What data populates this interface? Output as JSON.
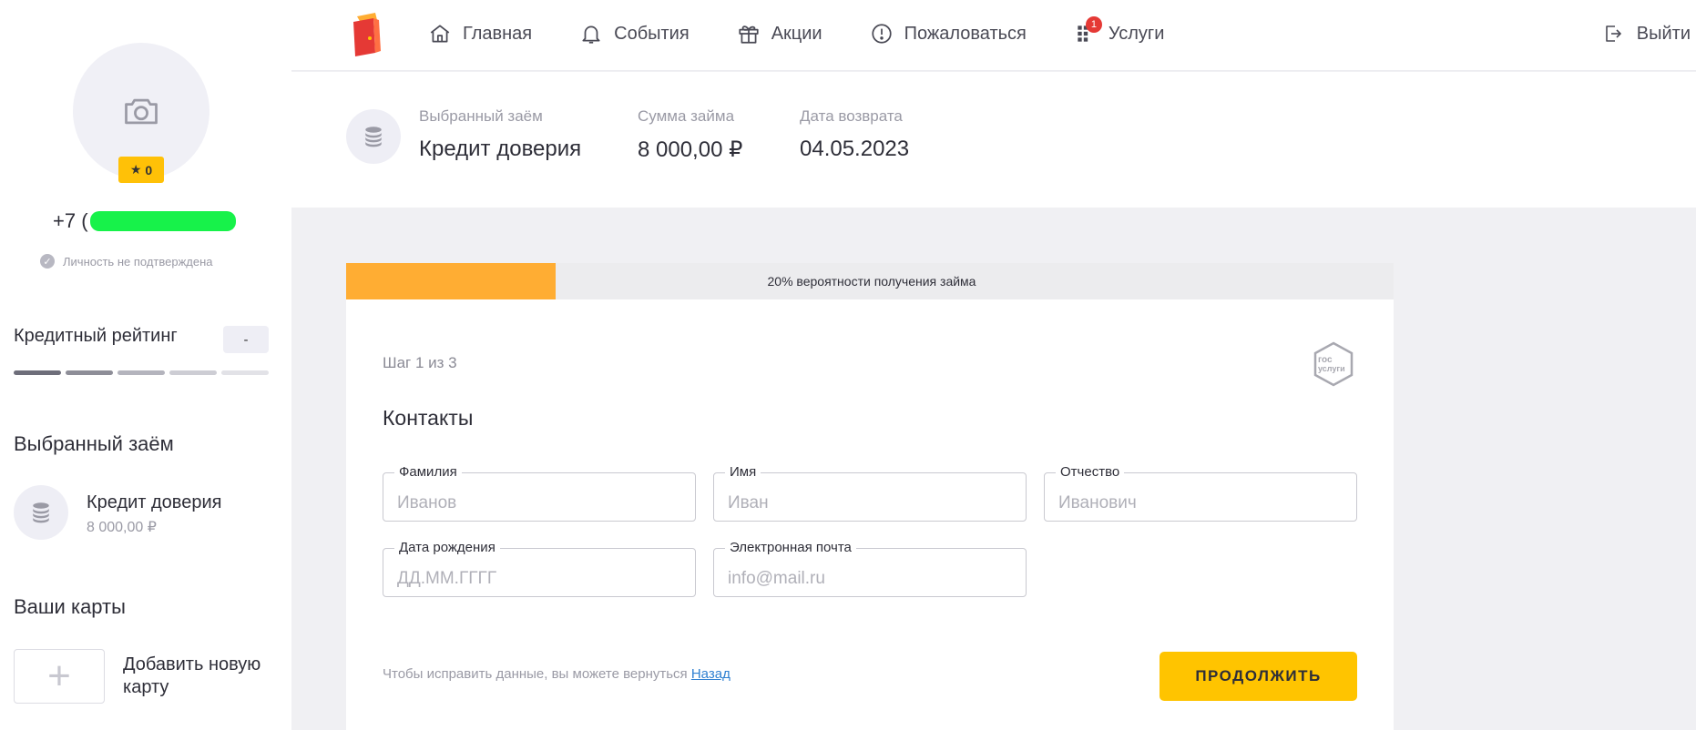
{
  "app": {
    "accent": "#ffc400",
    "progress_color": "#ffad33",
    "link_color": "#2f80d1"
  },
  "sidebar": {
    "avatar_icon": "camera-icon",
    "rating_badge": "0",
    "phone_prefix": "+7 (",
    "identity_status": "Личность не подтверждена",
    "credit_rating_label": "Кредитный рейтинг",
    "credit_rating_value": "-",
    "rating_bars": [
      "#6e6e7a",
      "#8e8e98",
      "#b4b4bd",
      "#cdcdd4",
      "#e2e2e7"
    ],
    "selected_loan_title": "Выбранный заём",
    "loan_name": "Кредит доверия",
    "loan_sum": "8 000,00 ₽",
    "cards_title": "Ваши карты",
    "add_card_label": "Добавить новую карту"
  },
  "header": {
    "nav": [
      {
        "label": "Главная",
        "icon": "home-icon"
      },
      {
        "label": "События",
        "icon": "bell-icon"
      },
      {
        "label": "Акции",
        "icon": "gift-icon"
      },
      {
        "label": "Пожаловаться",
        "icon": "exclamation-icon"
      },
      {
        "label": "Услуги",
        "icon": "grid-icon",
        "badge": "1"
      }
    ],
    "logout_label": "Выйти"
  },
  "loan_band": {
    "selected_label": "Выбранный заём",
    "selected_value": "Кредит доверия",
    "sum_label": "Сумма займа",
    "sum_value": "8 000,00 ₽",
    "date_label": "Дата возврата",
    "date_value": "04.05.2023"
  },
  "form": {
    "progress_percent": 20,
    "progress_label": "20% вероятности получения займа",
    "step": "Шаг 1 из 3",
    "gos_logo_line1": "гос",
    "gos_logo_line2": "услуги",
    "section_title": "Контакты",
    "fields": {
      "last_name": {
        "label": "Фамилия",
        "placeholder": "Иванов"
      },
      "first_name": {
        "label": "Имя",
        "placeholder": "Иван"
      },
      "patronymic": {
        "label": "Отчество",
        "placeholder": "Иванович"
      },
      "birth_date": {
        "label": "Дата рождения",
        "placeholder": "ДД.ММ.ГГГГ"
      },
      "email": {
        "label": "Электронная почта",
        "placeholder": "info@mail.ru"
      }
    },
    "back_text": "Чтобы исправить данные, вы можете вернуться",
    "back_link": "Назад",
    "continue_label": "ПРОДОЛЖИТЬ"
  }
}
